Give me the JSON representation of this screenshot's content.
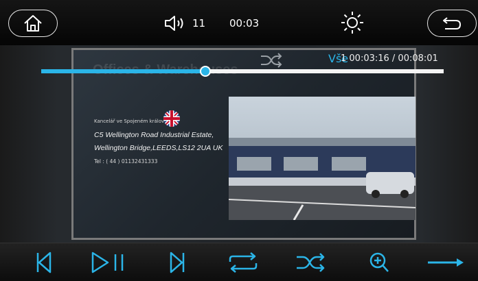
{
  "status_bar": {
    "volume_level": "11",
    "clock": "00:03"
  },
  "screen": {
    "sign_title": "Offices & Warehouses",
    "address_label": "Kancelář ve Spojeném království :",
    "address_line1": "C5 Wellington Road Industrial Estate,",
    "address_line2": "Wellington Bridge,LEEDS,LS12 2UA UK",
    "phone": "Tel : ( 44 ) 01132431333"
  },
  "player": {
    "repeat_mode": "Vše",
    "track_info": "1 00:03:16 / 00:08:01",
    "progress_fraction": 0.408
  },
  "colors": {
    "accent": "#2bb5e8",
    "background": "#0b0b0b"
  },
  "icons": {
    "home": "home-icon",
    "volume": "speaker-icon",
    "brightness": "sun-icon",
    "back": "return-arrow-icon",
    "shuffle": "shuffle-icon",
    "prev": "skip-previous-icon",
    "play_pause": "play-pause-icon",
    "next": "skip-next-icon",
    "repeat": "repeat-icon",
    "zoom": "zoom-in-icon",
    "more": "arrow-right-icon"
  }
}
